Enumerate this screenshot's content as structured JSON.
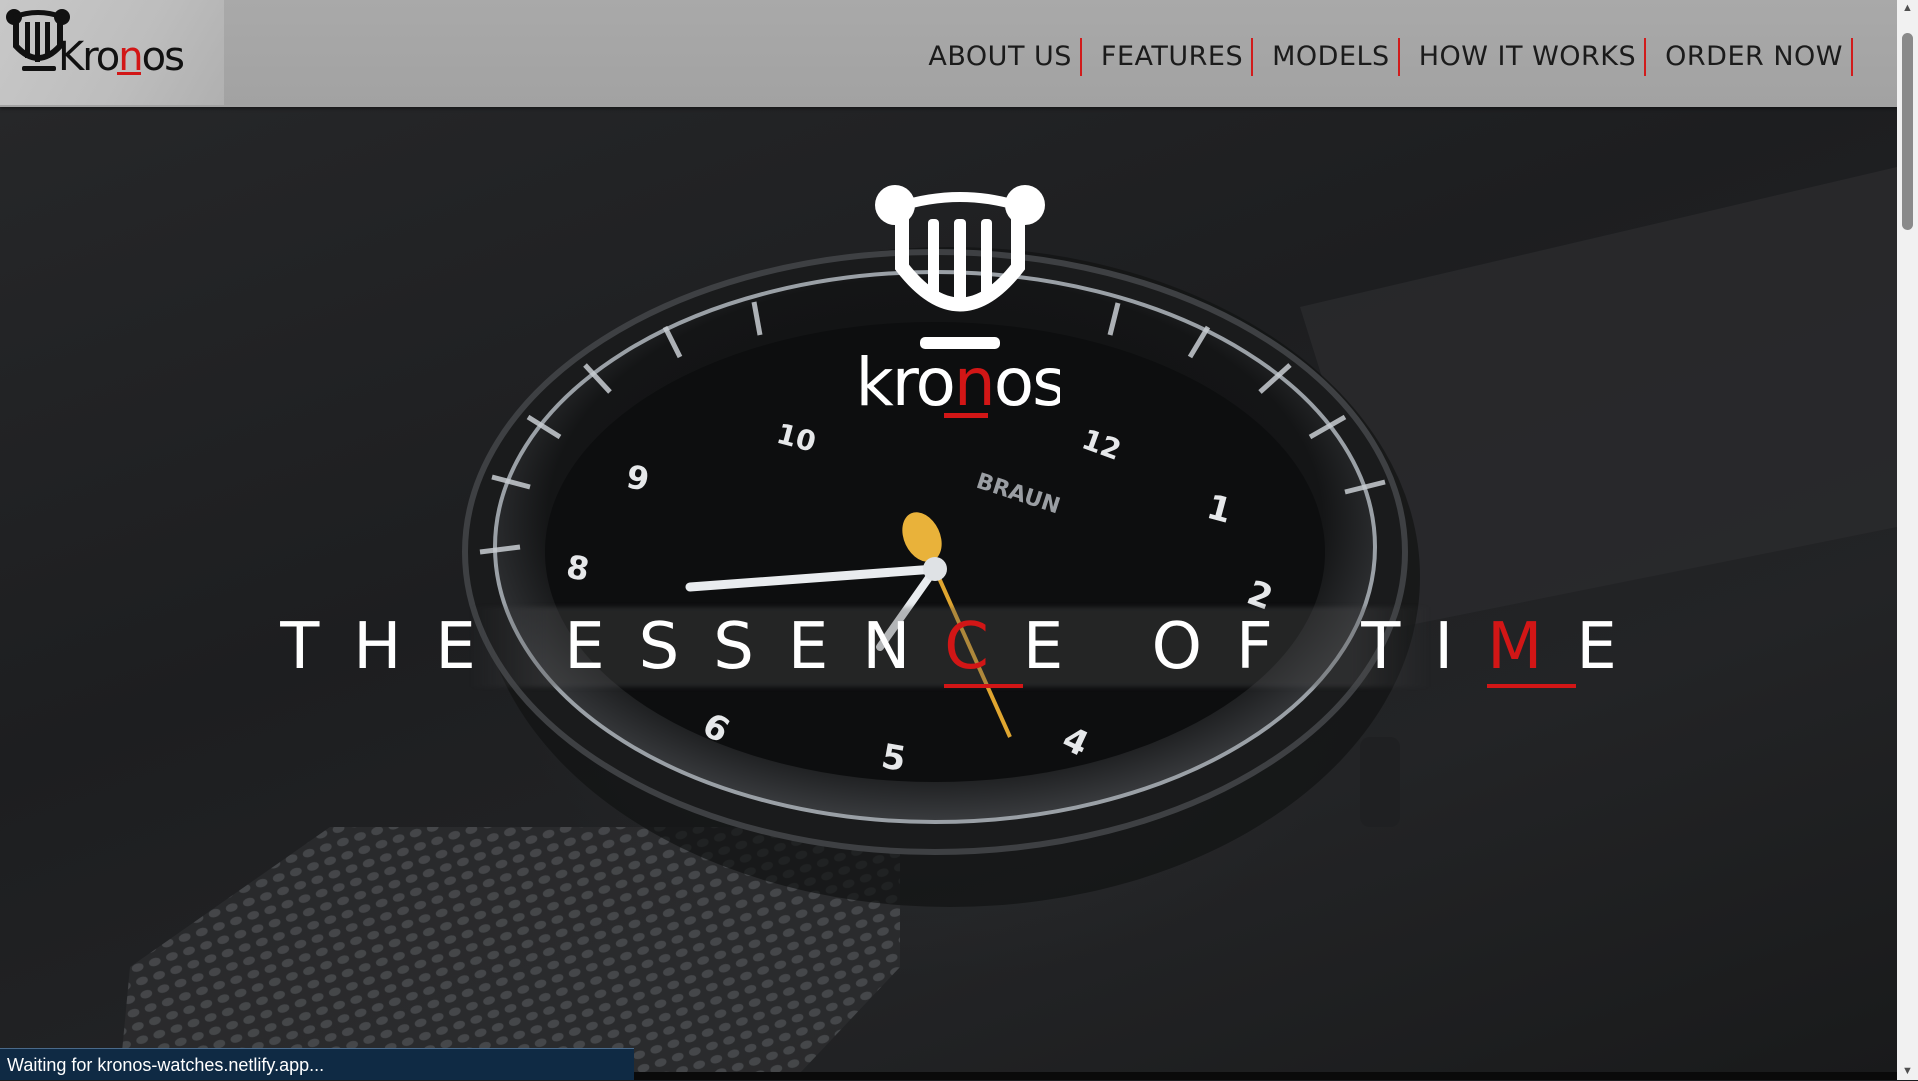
{
  "brand": {
    "name_prefix": "Kro",
    "name_highlight": "n",
    "name_suffix": "os"
  },
  "nav": {
    "items": [
      {
        "label": "ABOUT US"
      },
      {
        "label": "FEATURES"
      },
      {
        "label": "MODELS"
      },
      {
        "label": "HOW IT WORKS"
      },
      {
        "label": "ORDER NOW"
      }
    ]
  },
  "hero": {
    "logo_text_prefix": "kro",
    "logo_text_highlight": "n",
    "logo_text_suffix": "os",
    "tagline": {
      "part1": "THE ESSEN",
      "highlight1": "C",
      "part2": "E OF TI",
      "highlight2": "M",
      "part3": "E"
    },
    "watch": {
      "brand_mark": "BRAUN",
      "numerals": [
        "1",
        "2",
        "4",
        "5",
        "6",
        "8",
        "9",
        "10",
        "12"
      ]
    }
  },
  "status_bar": {
    "text": "Waiting for kronos-watches.netlify.app..."
  },
  "colors": {
    "accent": "#d21616",
    "header_bg": "#a9a9a9",
    "hero_bg": "#1c1d1f",
    "status_bg": "#0f2a44"
  }
}
